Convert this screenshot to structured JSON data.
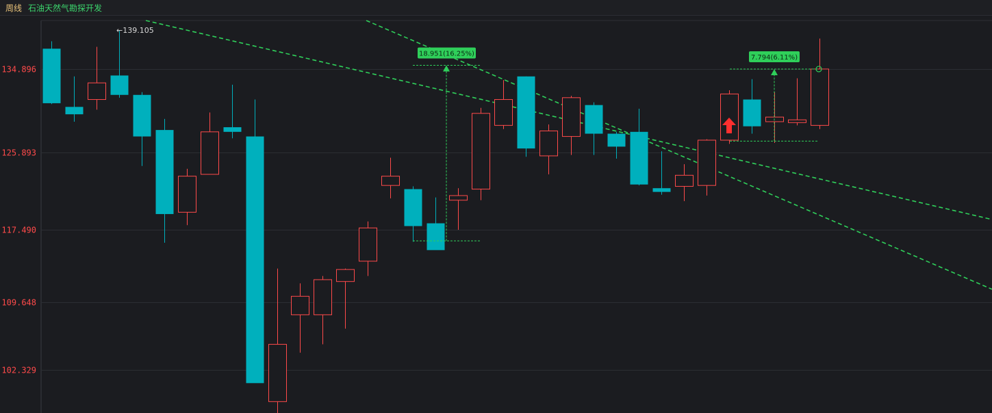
{
  "header": {
    "period_label": "周线",
    "stock_name": "石油天然气勘探开发"
  },
  "colors": {
    "up": "#ff4a4a",
    "down": "#00b0bd",
    "trend": "#2fcf5a",
    "grid": "#2c2e33",
    "annotation_bg": "#2fcf5a"
  },
  "chart_data": {
    "type": "candlestick",
    "interval": "weekly",
    "y_ticks": [
      "134.896",
      "125.893",
      "117.490",
      "109.648",
      "102.329"
    ],
    "ylim": [
      97.9,
      141.6
    ],
    "peak_label": "←139.105",
    "candles": [
      {
        "o": 137.1,
        "h": 137.9,
        "l": 131.1,
        "c": 131.2
      },
      {
        "o": 130.8,
        "h": 134.1,
        "l": 129.2,
        "c": 130.0
      },
      {
        "o": 131.6,
        "h": 137.3,
        "l": 130.5,
        "c": 133.4
      },
      {
        "o": 134.2,
        "h": 139.1,
        "l": 131.8,
        "c": 132.1
      },
      {
        "o": 132.1,
        "h": 132.4,
        "l": 124.4,
        "c": 127.6
      },
      {
        "o": 128.3,
        "h": 129.5,
        "l": 116.1,
        "c": 119.2
      },
      {
        "o": 119.4,
        "h": 124.1,
        "l": 118.0,
        "c": 123.3
      },
      {
        "o": 123.5,
        "h": 130.2,
        "l": 123.5,
        "c": 128.1
      },
      {
        "o": 128.6,
        "h": 133.2,
        "l": 127.4,
        "c": 128.1
      },
      {
        "o": 127.6,
        "h": 131.6,
        "l": 102.4,
        "c": 100.9
      },
      {
        "o": 98.9,
        "h": 113.3,
        "l": 96.8,
        "c": 105.1
      },
      {
        "o": 108.3,
        "h": 111.7,
        "l": 104.2,
        "c": 110.3
      },
      {
        "o": 108.3,
        "h": 112.5,
        "l": 105.1,
        "c": 112.1
      },
      {
        "o": 111.9,
        "h": 113.3,
        "l": 106.8,
        "c": 113.2
      },
      {
        "o": 114.1,
        "h": 118.4,
        "l": 112.5,
        "c": 117.7
      },
      {
        "o": 122.3,
        "h": 125.3,
        "l": 120.9,
        "c": 123.3
      },
      {
        "o": 121.9,
        "h": 122.2,
        "l": 116.2,
        "c": 117.9
      },
      {
        "o": 118.2,
        "h": 121.0,
        "l": 116.6,
        "c": 115.3
      },
      {
        "o": 120.7,
        "h": 122.0,
        "l": 117.5,
        "c": 121.2
      },
      {
        "o": 121.9,
        "h": 130.7,
        "l": 120.7,
        "c": 130.1
      },
      {
        "o": 128.8,
        "h": 133.7,
        "l": 128.4,
        "c": 131.6
      },
      {
        "o": 134.1,
        "h": 134.1,
        "l": 125.4,
        "c": 126.3
      },
      {
        "o": 125.5,
        "h": 128.9,
        "l": 123.5,
        "c": 128.2
      },
      {
        "o": 127.6,
        "h": 132.0,
        "l": 125.6,
        "c": 131.8
      },
      {
        "o": 131.0,
        "h": 131.3,
        "l": 125.6,
        "c": 127.9
      },
      {
        "o": 127.9,
        "h": 128.1,
        "l": 125.2,
        "c": 126.5
      },
      {
        "o": 128.1,
        "h": 130.6,
        "l": 122.3,
        "c": 122.4
      },
      {
        "o": 122.0,
        "h": 126.0,
        "l": 121.3,
        "c": 121.6
      },
      {
        "o": 122.2,
        "h": 124.6,
        "l": 120.6,
        "c": 123.4
      },
      {
        "o": 122.3,
        "h": 127.3,
        "l": 121.2,
        "c": 127.2
      },
      {
        "o": 127.2,
        "h": 132.6,
        "l": 126.8,
        "c": 132.2
      },
      {
        "o": 131.6,
        "h": 133.8,
        "l": 127.9,
        "c": 128.7
      },
      {
        "o": 129.2,
        "h": 132.4,
        "l": 126.9,
        "c": 129.7
      },
      {
        "o": 129.1,
        "h": 133.9,
        "l": 128.8,
        "c": 129.4
      },
      {
        "o": 128.8,
        "h": 138.2,
        "l": 128.4,
        "c": 134.9
      }
    ],
    "annotations": [
      {
        "label": "18.951(16.25%)",
        "from": 116.3,
        "to": 135.3
      },
      {
        "label": "7.794(6.11%)",
        "from": 127.1,
        "to": 134.9
      }
    ],
    "trend_lines": [
      "upper channel line",
      "lower channel line"
    ]
  }
}
